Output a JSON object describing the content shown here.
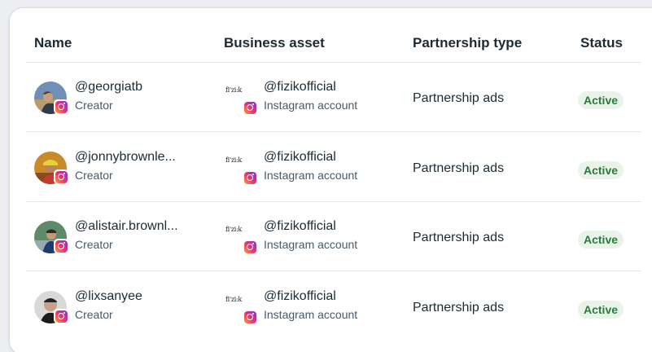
{
  "table": {
    "headers": {
      "name": "Name",
      "business_asset": "Business asset",
      "partnership_type": "Partnership type",
      "status": "Status"
    },
    "rows": [
      {
        "handle": "@georgiatb",
        "role": "Creator",
        "asset_logo": "fi'zi:k",
        "asset_handle": "@fizikofficial",
        "asset_type": "Instagram account",
        "partnership_type": "Partnership ads",
        "status": "Active",
        "avatar_icon": "creator-avatar"
      },
      {
        "handle": "@jonnybrownle...",
        "role": "Creator",
        "asset_logo": "fi'zi:k",
        "asset_handle": "@fizikofficial",
        "asset_type": "Instagram account",
        "partnership_type": "Partnership ads",
        "status": "Active",
        "avatar_icon": "creator-avatar"
      },
      {
        "handle": "@alistair.brownl...",
        "role": "Creator",
        "asset_logo": "fi'zi:k",
        "asset_handle": "@fizikofficial",
        "asset_type": "Instagram account",
        "partnership_type": "Partnership ads",
        "status": "Active",
        "avatar_icon": "creator-avatar"
      },
      {
        "handle": "@lixsanyee",
        "role": "Creator",
        "asset_logo": "fi'zi:k",
        "asset_handle": "@fizikofficial",
        "asset_type": "Instagram account",
        "partnership_type": "Partnership ads",
        "status": "Active",
        "avatar_icon": "creator-avatar"
      }
    ]
  },
  "colors": {
    "status_active_text": "#2a7b3b",
    "status_active_bg": "#e9f3ea",
    "primary_text": "#1c2b33",
    "secondary_text": "#465a69"
  },
  "icons": {
    "platform": "instagram-icon"
  }
}
